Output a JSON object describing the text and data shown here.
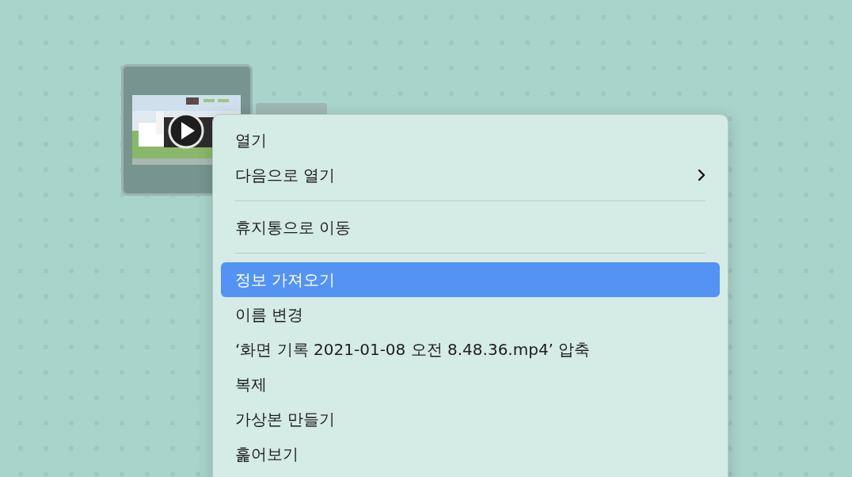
{
  "context_menu": {
    "items": [
      {
        "kind": "item",
        "label": "열기",
        "submenu": false,
        "selected": false
      },
      {
        "kind": "item",
        "label": "다음으로 열기",
        "submenu": true,
        "selected": false
      },
      {
        "kind": "separator"
      },
      {
        "kind": "item",
        "label": "휴지통으로 이동",
        "submenu": false,
        "selected": false
      },
      {
        "kind": "separator"
      },
      {
        "kind": "item",
        "label": "정보 가져오기",
        "submenu": false,
        "selected": true
      },
      {
        "kind": "item",
        "label": "이름 변경",
        "submenu": false,
        "selected": false
      },
      {
        "kind": "item",
        "label": "‘화면 기록 2021-01-08 오전 8.48.36.mp4’ 압축",
        "submenu": false,
        "selected": false
      },
      {
        "kind": "item",
        "label": "복제",
        "submenu": false,
        "selected": false
      },
      {
        "kind": "item",
        "label": "가상본 만들기",
        "submenu": false,
        "selected": false
      },
      {
        "kind": "item",
        "label": "훑어보기",
        "submenu": false,
        "selected": false
      }
    ]
  }
}
